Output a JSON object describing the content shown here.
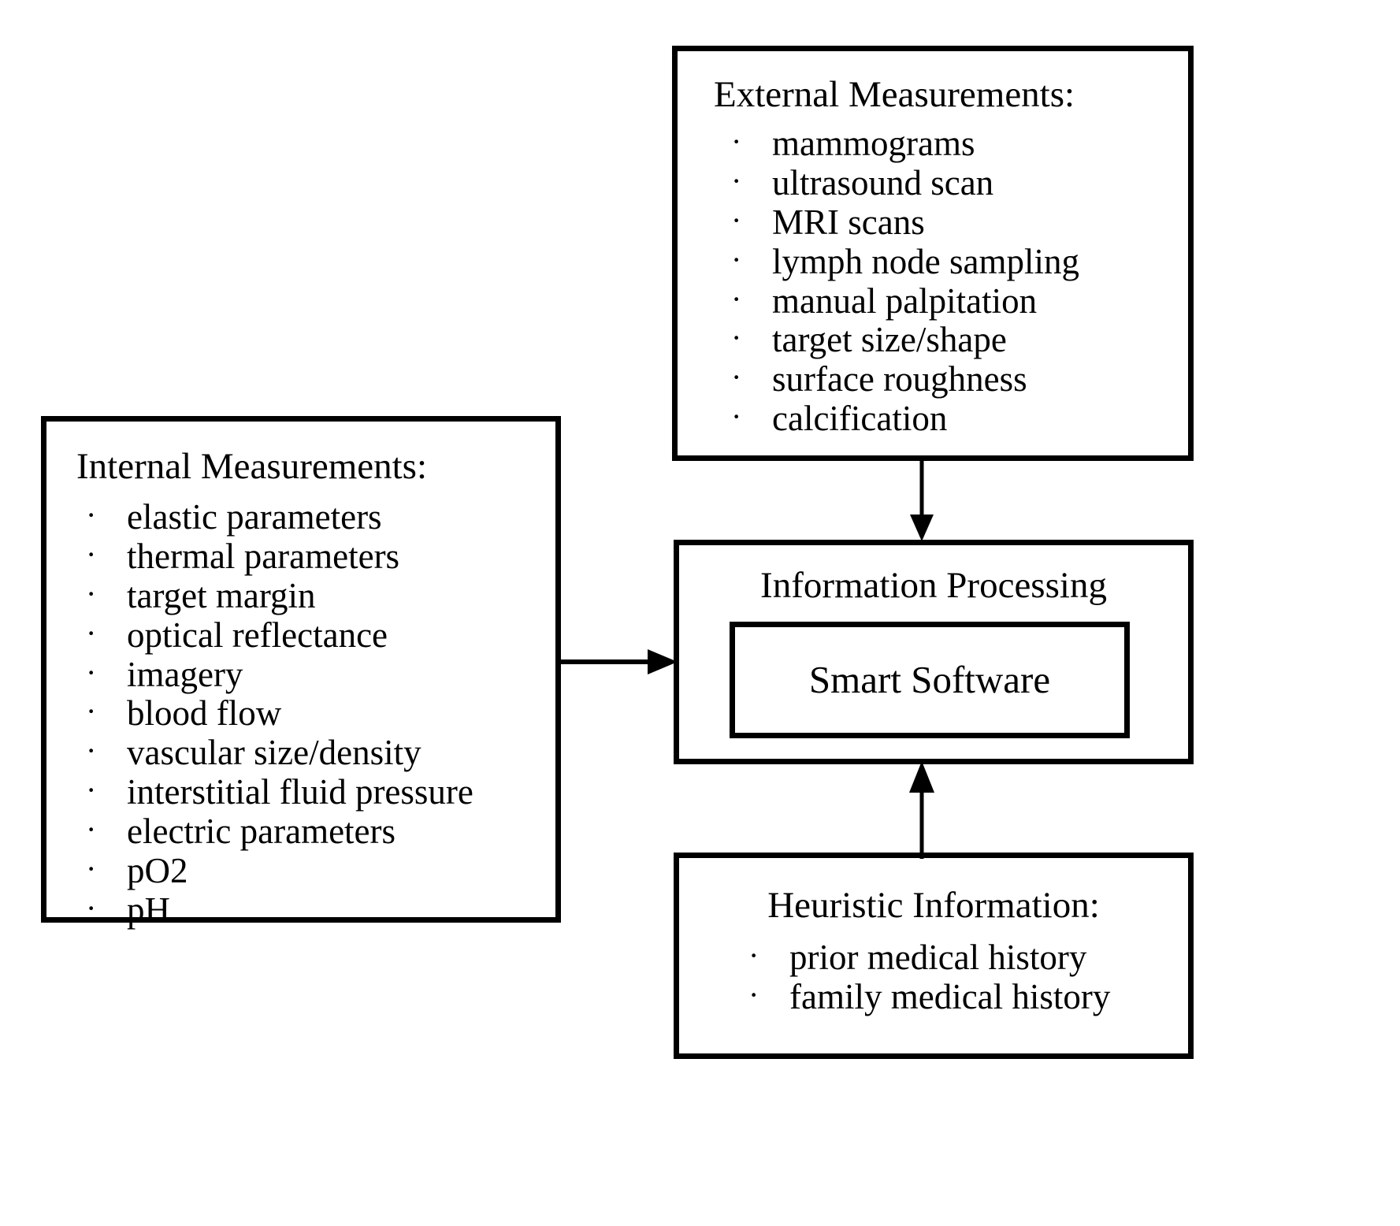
{
  "diagram": {
    "nodes": {
      "external": {
        "title": "External Measurements:",
        "items": [
          "mammograms",
          "ultrasound scan",
          "MRI scans",
          "lymph node sampling",
          "manual palpitation",
          "target size/shape",
          "surface roughness",
          "calcification"
        ]
      },
      "internal": {
        "title": "Internal Measurements:",
        "items": [
          "elastic parameters",
          "thermal parameters",
          "target margin",
          "optical reflectance",
          "imagery",
          "blood flow",
          "vascular size/density",
          "interstitial fluid pressure",
          "electric parameters",
          "pO2",
          "pH"
        ]
      },
      "processing": {
        "title": "Information Processing",
        "inner_label": "Smart Software"
      },
      "heuristic": {
        "title": "Heuristic Information:",
        "items": [
          "prior medical history",
          "family medical history"
        ]
      }
    },
    "bullet_glyph": "·",
    "edges": [
      {
        "name": "external-to-processing",
        "from": "external",
        "to": "processing",
        "direction": "down"
      },
      {
        "name": "internal-to-processing",
        "from": "internal",
        "to": "processing",
        "direction": "right"
      },
      {
        "name": "heuristic-to-processing",
        "from": "heuristic",
        "to": "processing",
        "direction": "up"
      }
    ],
    "colors": {
      "background": "#ffffff",
      "stroke": "#000000",
      "text": "#000000"
    }
  }
}
